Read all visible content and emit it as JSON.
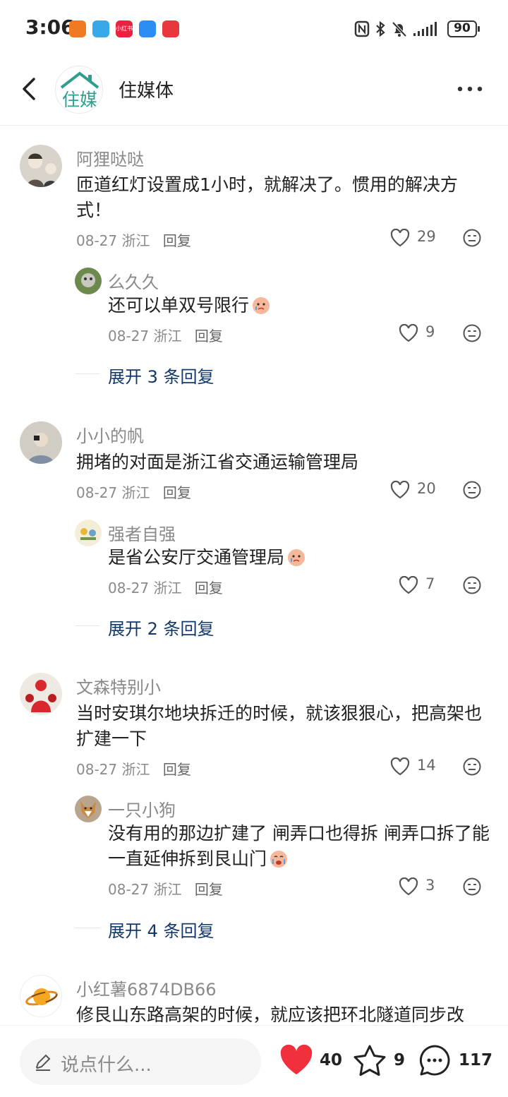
{
  "status_bar": {
    "time": "3:06",
    "battery": "90",
    "app_icons": [
      "xiaohongshu-label-icon",
      "browser-icon",
      "xiaohongshu-icon",
      "cloud-icon",
      "mail-icon"
    ],
    "app_icon_label": "小红书"
  },
  "header": {
    "title": "住媒体",
    "logo_text": "住媒"
  },
  "comments": [
    {
      "user": "阿狸哒哒",
      "text": "匝道红灯设置成1小时，就解决了。惯用的解决方式！",
      "date": "08-27",
      "location": "浙江",
      "reply_label": "回复",
      "likes": "29",
      "reply": {
        "user": "么久久",
        "text": "还可以单双号限行",
        "date": "08-27",
        "location": "浙江",
        "reply_label": "回复",
        "likes": "9"
      },
      "expand": "展开 3 条回复"
    },
    {
      "user": "小小的帆",
      "text": "拥堵的对面是浙江省交通运输管理局",
      "date": "08-27",
      "location": "浙江",
      "reply_label": "回复",
      "likes": "20",
      "reply": {
        "user": "强者自强",
        "text": "是省公安厅交通管理局",
        "date": "08-27",
        "location": "浙江",
        "reply_label": "回复",
        "likes": "7"
      },
      "expand": "展开 2 条回复"
    },
    {
      "user": "文森特别小",
      "text": "当时安琪尔地块拆迁的时候，就该狠狠心，把高架也扩建一下",
      "date": "08-27",
      "location": "浙江",
      "reply_label": "回复",
      "likes": "14",
      "reply": {
        "user": "一只小狗",
        "text": "没有用的那边扩建了 闸弄口也得拆 闸弄口拆了能一直延伸拆到艮山门",
        "date": "08-27",
        "location": "浙江",
        "reply_label": "回复",
        "likes": "3"
      },
      "expand": "展开 4 条回复"
    },
    {
      "user": "小红薯6874DB66",
      "text": "修艮山东路高架的时候，就应该把环北隧道同步改"
    }
  ],
  "bottom_bar": {
    "input_placeholder": "说点什么...",
    "likes": "40",
    "favorites": "9",
    "comments": "117"
  },
  "colors": {
    "like_red": "#f0303d",
    "link_blue": "#13386c",
    "logo_teal": "#2e9e8f"
  }
}
